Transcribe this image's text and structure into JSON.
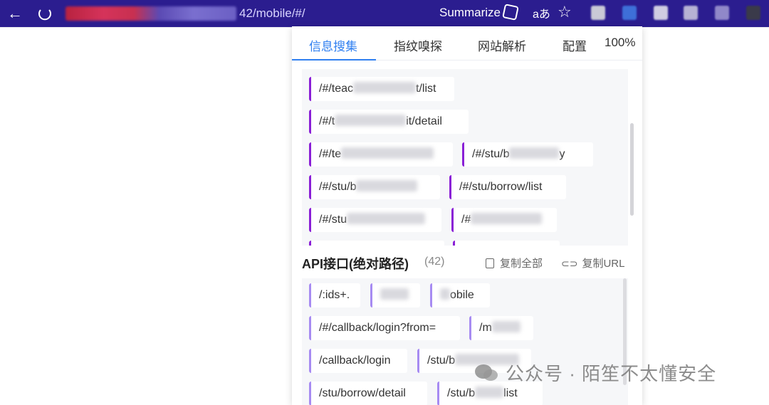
{
  "browser": {
    "url_visible": "42/mobile/#/",
    "summarize_label": "Summarize",
    "translate_glyph": "aあ",
    "back_glyph": "←",
    "star_glyph": "☆"
  },
  "colors": {
    "topbar": "#2b1d8f",
    "accent": "#2f7ff0",
    "bar_primary": "#8a1fd6",
    "bar_secondary": "#a78bf2"
  },
  "tabs": [
    {
      "label": "信息搜集",
      "active": true
    },
    {
      "label": "指纹嗅探",
      "active": false
    },
    {
      "label": "网站解析",
      "active": false
    },
    {
      "label": "配置",
      "active": false
    }
  ],
  "zoom": "100%",
  "paths_section": {
    "items": [
      {
        "prefix": "/#/teac",
        "suffix": "t/list"
      },
      {
        "prefix": "/#/t",
        "suffix": "it/detail"
      },
      {
        "prefix": "/#/te",
        "suffix": ""
      },
      {
        "prefix": "/#/stu/b",
        "suffix": "y"
      },
      {
        "prefix": "/#/stu/b",
        "suffix": ""
      },
      {
        "prefix": "/#/stu/borrow/list",
        "suffix": ""
      },
      {
        "prefix": "/#/stu",
        "suffix": ""
      },
      {
        "prefix": "/#",
        "suffix": ""
      }
    ]
  },
  "api_section": {
    "title": "API接口(绝对路径)",
    "count": "(42)",
    "copy_all": "复制全部",
    "copy_url": "复制URL",
    "items": [
      {
        "prefix": "/:ids+.",
        "suffix": ""
      },
      {
        "prefix": "",
        "suffix": ""
      },
      {
        "prefix": "",
        "suffix": "obile"
      },
      {
        "prefix": "/#/callback/login?from=",
        "suffix": ""
      },
      {
        "prefix": "/m",
        "suffix": ""
      },
      {
        "prefix": "/callback/login",
        "suffix": ""
      },
      {
        "prefix": "/stu/b",
        "suffix": ""
      },
      {
        "prefix": "/stu/borrow/detail",
        "suffix": ""
      },
      {
        "prefix": "/stu/b",
        "suffix": "list"
      }
    ]
  },
  "watermark": "公众号 · 陌笙不太懂安全"
}
